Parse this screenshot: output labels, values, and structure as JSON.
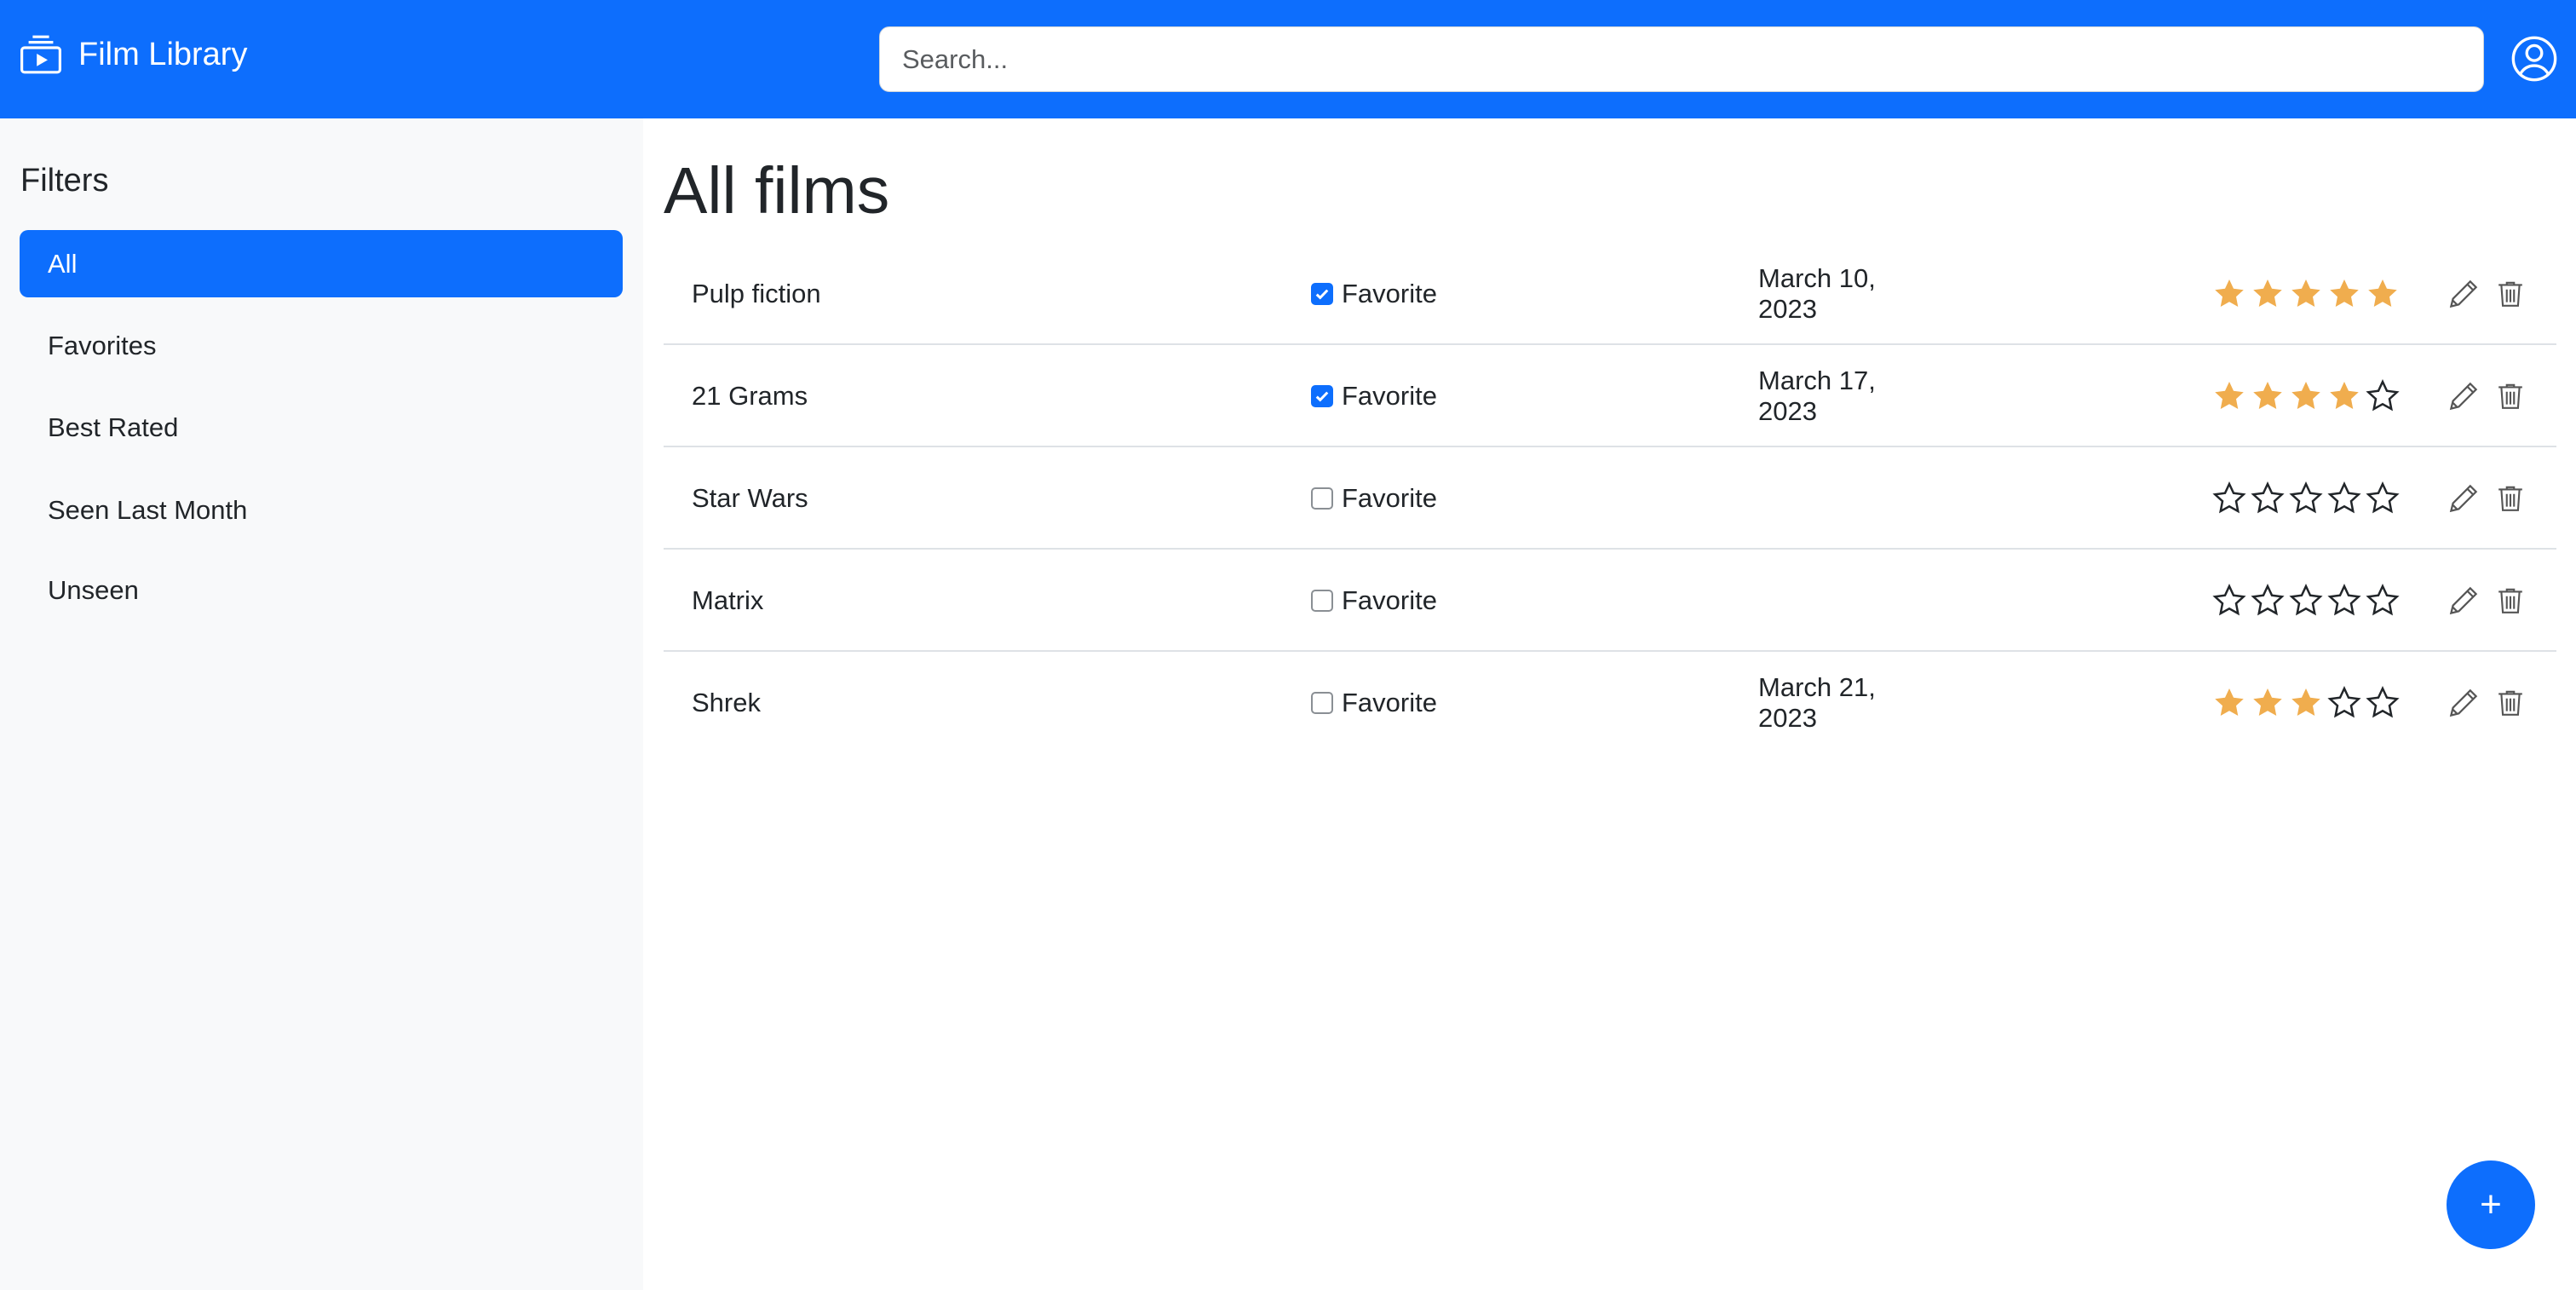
{
  "app": {
    "title": "Film Library",
    "icon": "collection-play-icon"
  },
  "search": {
    "placeholder": "Search...",
    "value": ""
  },
  "profile": {
    "icon": "person-circle-icon"
  },
  "sidebar": {
    "title": "Filters",
    "items": [
      {
        "label": "All",
        "active": true
      },
      {
        "label": "Favorites",
        "active": false
      },
      {
        "label": "Best Rated",
        "active": false
      },
      {
        "label": "Seen Last Month",
        "active": false
      },
      {
        "label": "Unseen",
        "active": false
      }
    ]
  },
  "main": {
    "title": "All films",
    "favorite_label": "Favorite",
    "films": [
      {
        "title": "Pulp fiction",
        "favorite": true,
        "date": "March 10, 2023",
        "rating": 5
      },
      {
        "title": "21 Grams",
        "favorite": true,
        "date": "March 17, 2023",
        "rating": 4
      },
      {
        "title": "Star Wars",
        "favorite": false,
        "date": "",
        "rating": 0
      },
      {
        "title": "Matrix",
        "favorite": false,
        "date": "",
        "rating": 0
      },
      {
        "title": "Shrek",
        "favorite": false,
        "date": "March 21, 2023",
        "rating": 3
      }
    ]
  },
  "fab": {
    "label": "+"
  },
  "colors": {
    "primary": "#0d6efd",
    "star": "#f0ad4e",
    "sidebar_bg": "#f8f9fa"
  }
}
